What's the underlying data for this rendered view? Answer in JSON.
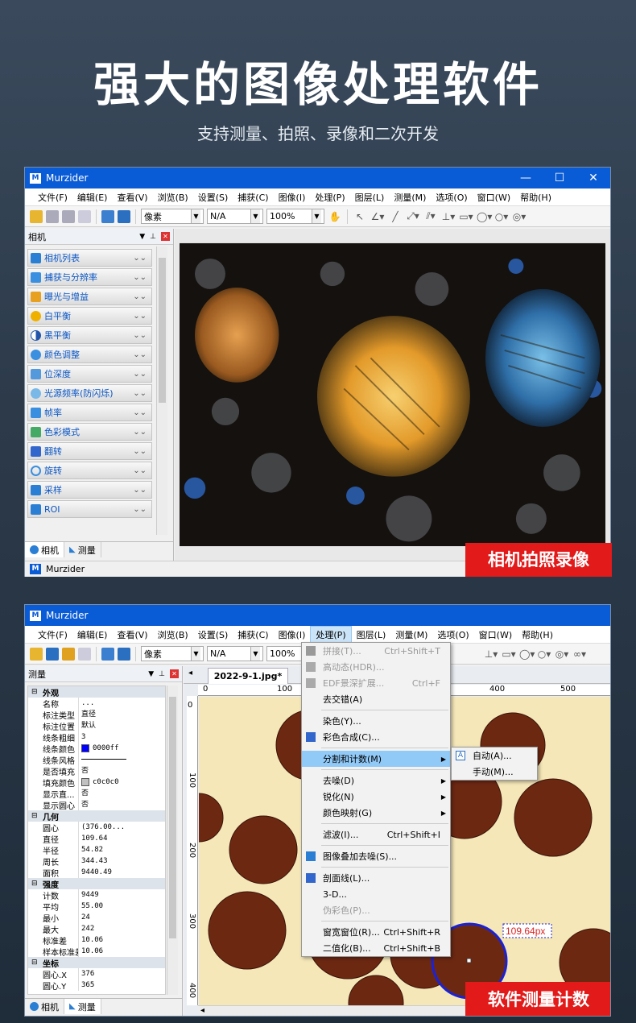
{
  "hero": {
    "title": "强大的图像处理软件",
    "subtitle": "支持测量、拍照、录像和二次开发"
  },
  "app": {
    "name": "Murzider",
    "logo_text": "M"
  },
  "menu": [
    "文件(F)",
    "编辑(E)",
    "查看(V)",
    "浏览(B)",
    "设置(S)",
    "捕获(C)",
    "图像(I)",
    "处理(P)",
    "图层(L)",
    "测量(M)",
    "选项(O)",
    "窗口(W)",
    "帮助(H)"
  ],
  "toolbar": {
    "unit": "像素",
    "na": "N/A",
    "zoom": "100%"
  },
  "win1": {
    "panel_title": "相机",
    "accordion": [
      {
        "label": "相机列表",
        "icon_color": "#2a7fd4"
      },
      {
        "label": "捕获与分辨率",
        "icon_color": "#3a8fe0"
      },
      {
        "label": "曝光与增益",
        "icon_color": "#e8a020"
      },
      {
        "label": "白平衡",
        "icon_color": "#f0b000"
      },
      {
        "label": "黑平衡",
        "icon_color": "#2255aa"
      },
      {
        "label": "颜色调整",
        "icon_color": "#3a8fe0"
      },
      {
        "label": "位深度",
        "icon_color": "#5599dd"
      },
      {
        "label": "光源频率(防闪烁)",
        "icon_color": "#7ab8e8"
      },
      {
        "label": "帧率",
        "icon_color": "#3a8fe0"
      },
      {
        "label": "色彩模式",
        "icon_color": "#44aa66"
      },
      {
        "label": "翻转",
        "icon_color": "#3366cc"
      },
      {
        "label": "旋转",
        "icon_color": "#3a8fe0"
      },
      {
        "label": "采样",
        "icon_color": "#2a7fd4"
      },
      {
        "label": "ROI",
        "icon_color": "#2a7fd4"
      }
    ],
    "tabs": [
      "相机",
      "测量"
    ],
    "status": "Murzider",
    "badge": "相机拍照录像"
  },
  "win2": {
    "panel_title": "测量",
    "doc_tab": "2022-9-1.jpg*",
    "ruler_top": [
      "0",
      "100",
      "400",
      "500"
    ],
    "ruler_left": [
      "0",
      "100",
      "200",
      "300",
      "400"
    ],
    "props": [
      {
        "group": "外观",
        "rows": [
          {
            "k": "名称",
            "v": "..."
          },
          {
            "k": "标注类型",
            "v": "直径"
          },
          {
            "k": "标注位置",
            "v": "默认"
          },
          {
            "k": "线条粗细",
            "v": "3"
          },
          {
            "k": "线条颜色",
            "v": "0000ff",
            "swatch": "#0000ff"
          },
          {
            "k": "线条风格",
            "v": "",
            "line": true
          },
          {
            "k": "是否填充",
            "v": "否"
          },
          {
            "k": "填充颜色",
            "v": "c0c0c0",
            "swatch": "#c0c0c0"
          },
          {
            "k": "显示直...",
            "v": "否"
          },
          {
            "k": "显示圆心",
            "v": "否"
          }
        ]
      },
      {
        "group": "几何",
        "rows": [
          {
            "k": "圆心",
            "v": "(376.00..."
          },
          {
            "k": "直径",
            "v": "109.64"
          },
          {
            "k": "半径",
            "v": "54.82"
          },
          {
            "k": "周长",
            "v": "344.43"
          },
          {
            "k": "面积",
            "v": "9440.49"
          }
        ]
      },
      {
        "group": "强度",
        "rows": [
          {
            "k": "计数",
            "v": "9449"
          },
          {
            "k": "平均",
            "v": "55.00"
          },
          {
            "k": "最小",
            "v": "24"
          },
          {
            "k": "最大",
            "v": "242"
          },
          {
            "k": "标准差",
            "v": "10.06"
          },
          {
            "k": "样本标准差",
            "v": "10.06"
          }
        ]
      },
      {
        "group": "坐标",
        "rows": [
          {
            "k": "圆心.X",
            "v": "376"
          },
          {
            "k": "圆心.Y",
            "v": "365"
          }
        ]
      }
    ],
    "process_menu": [
      {
        "label": "拼接(T)...",
        "sc": "Ctrl+Shift+T",
        "dis": true,
        "icon": "#999"
      },
      {
        "label": "高动态(HDR)...",
        "dis": true,
        "icon": "#aaa"
      },
      {
        "label": "EDF景深扩展...",
        "sc": "Ctrl+F",
        "dis": true,
        "icon": "#aaa"
      },
      {
        "label": "去交错(A)"
      },
      {
        "sep": true
      },
      {
        "label": "染色(Y)..."
      },
      {
        "label": "彩色合成(C)...",
        "icon": "#3366cc"
      },
      {
        "sep": true
      },
      {
        "label": "分割和计数(M)",
        "arr": true,
        "hl": true
      },
      {
        "sep": true
      },
      {
        "label": "去噪(D)",
        "arr": true
      },
      {
        "label": "锐化(N)",
        "arr": true
      },
      {
        "label": "颜色映射(G)",
        "arr": true
      },
      {
        "sep": true
      },
      {
        "label": "滤波(I)...",
        "sc": "Ctrl+Shift+I"
      },
      {
        "sep": true
      },
      {
        "label": "图像叠加去噪(S)...",
        "icon": "#2a7fd4"
      },
      {
        "sep": true
      },
      {
        "label": "剖面线(L)...",
        "icon": "#3366cc"
      },
      {
        "label": "3-D..."
      },
      {
        "label": "伪彩色(P)...",
        "dis": true
      },
      {
        "sep": true
      },
      {
        "label": "窗宽窗位(R)...",
        "sc": "Ctrl+Shift+R"
      },
      {
        "label": "二值化(B)...",
        "sc": "Ctrl+Shift+B"
      }
    ],
    "submenu": [
      {
        "label": "自动(A)...",
        "icon_text": "A"
      },
      {
        "label": "手动(M)..."
      }
    ],
    "measure_label": "109.64px",
    "tabs": [
      "相机",
      "测量"
    ],
    "badge": "软件测量计数"
  }
}
